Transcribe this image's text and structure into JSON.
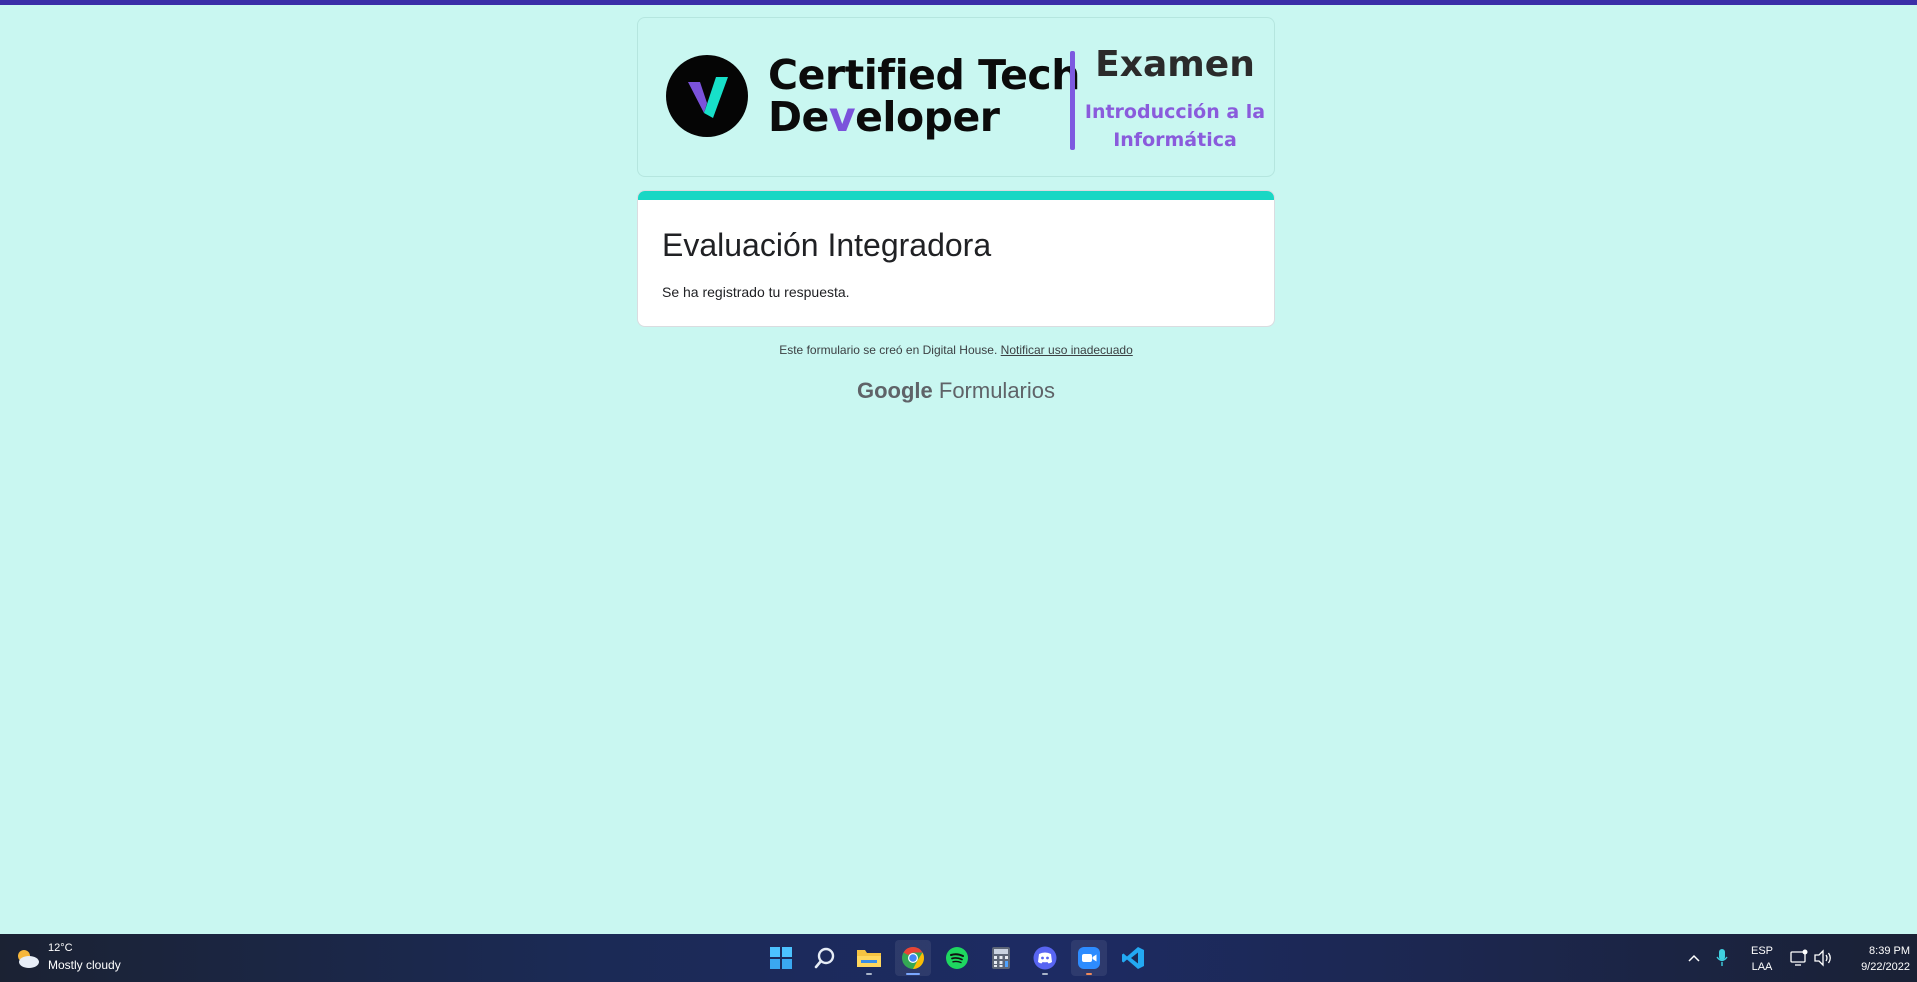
{
  "banner": {
    "brand_line1": "Certified Tech",
    "brand_line2_pre": "De",
    "brand_line2_v": "v",
    "brand_line2_post": "eloper",
    "exam_title": "Examen",
    "exam_subtitle_line1": "Introducción a la",
    "exam_subtitle_line2": "Informática"
  },
  "form": {
    "title": "Evaluación Integradora",
    "message": "Se ha registrado tu respuesta."
  },
  "footer": {
    "note": "Este formulario se creó en Digital House.",
    "report_link": "Notificar uso inadecuado",
    "google": "Google",
    "forms": "Formularios"
  },
  "taskbar": {
    "weather_temp": "12°C",
    "weather_desc": "Mostly cloudy",
    "apps": [
      "start-icon",
      "search-icon",
      "file-explorer-icon",
      "chrome-icon",
      "spotify-icon",
      "calculator-icon",
      "discord-icon",
      "zoom-icon",
      "vscode-icon"
    ],
    "lang_line1": "ESP",
    "lang_line2": "LAA",
    "time": "8:39 PM",
    "date": "9/22/2022"
  },
  "colors": {
    "page_bg": "#c9f7f1",
    "accent_teal": "#19d7c4",
    "accent_purple": "#7d5ae0",
    "top_line": "#3a2fa8"
  }
}
